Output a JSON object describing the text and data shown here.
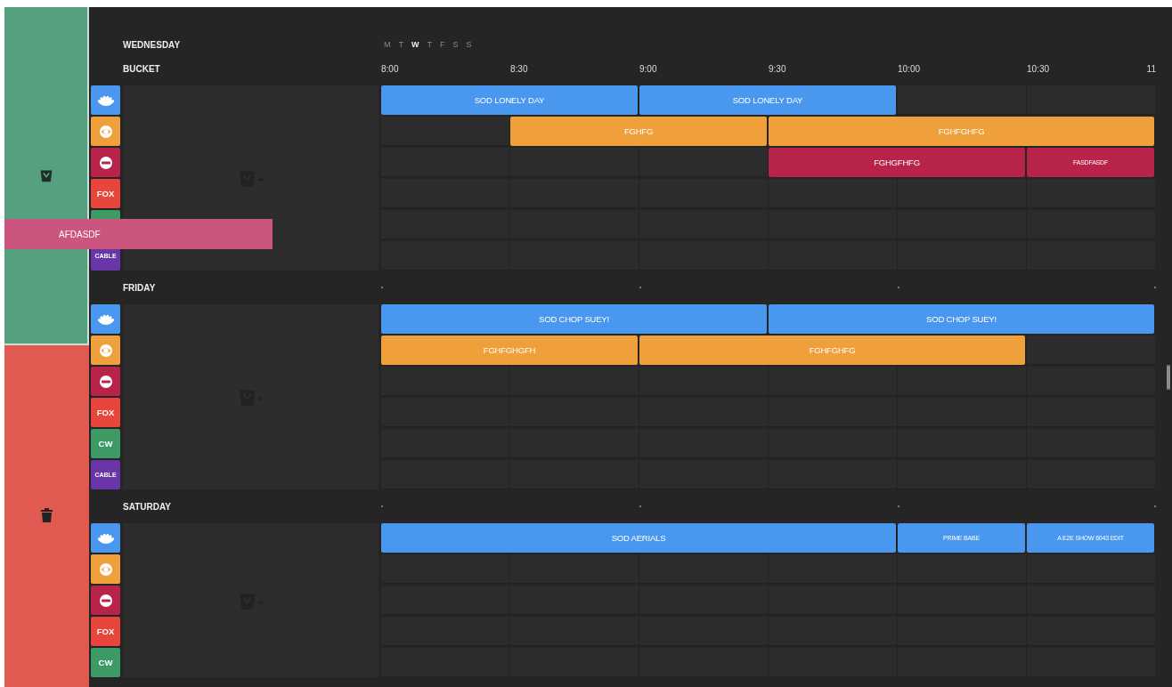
{
  "top_bar": {
    "day": "WEDNESDAY",
    "weekdays": [
      {
        "label": "M",
        "selected": false
      },
      {
        "label": "T",
        "selected": false
      },
      {
        "label": "W",
        "selected": true
      },
      {
        "label": "T",
        "selected": false
      },
      {
        "label": "F",
        "selected": false
      },
      {
        "label": "S",
        "selected": false
      },
      {
        "label": "S",
        "selected": false
      }
    ]
  },
  "header": {
    "bucket_label": "BUCKET",
    "times": [
      "8:00",
      "8:30",
      "9:00",
      "9:30",
      "10:00",
      "10:30",
      "11"
    ]
  },
  "dragged_program": {
    "title": "AFDASDF"
  },
  "days": [
    {
      "rows": [
        {
          "channel": {
            "kind": "nbc",
            "color": "#4a97f0"
          },
          "slots": [
            {
              "kind": "program",
              "title": "SOD LONELY DAY"
            },
            {
              "kind": "continued"
            },
            {
              "kind": "program",
              "title": "SOD LONELY DAY"
            },
            {
              "kind": "continued"
            },
            {
              "kind": "empty"
            },
            {
              "kind": "empty"
            }
          ]
        },
        {
          "channel": {
            "kind": "cbs",
            "color": "#f0a03a"
          },
          "slots": [
            {
              "kind": "empty"
            },
            {
              "kind": "program",
              "title": "FGHFG"
            },
            {
              "kind": "continued"
            },
            {
              "kind": "program",
              "title": "FGHFGHFG"
            },
            {
              "kind": "continued"
            },
            {
              "kind": "continued"
            }
          ]
        },
        {
          "channel": {
            "kind": "abc",
            "color": "#b8234a"
          },
          "slots": [
            {
              "kind": "empty"
            },
            {
              "kind": "empty"
            },
            {
              "kind": "empty"
            },
            {
              "kind": "program",
              "title": "FGHGFHFG"
            },
            {
              "kind": "continued"
            },
            {
              "kind": "program",
              "title": "FASDFASDF"
            }
          ]
        },
        {
          "channel": {
            "kind": "text",
            "label": "FOX",
            "color": "#e8453c"
          },
          "slots": [
            {
              "kind": "empty"
            },
            {
              "kind": "empty"
            },
            {
              "kind": "empty"
            },
            {
              "kind": "empty"
            },
            {
              "kind": "empty"
            },
            {
              "kind": "empty"
            }
          ]
        },
        {
          "channel": {
            "kind": "text",
            "color": "#3e9a64"
          },
          "slots": [
            {
              "kind": "empty"
            },
            {
              "kind": "empty"
            },
            {
              "kind": "empty"
            },
            {
              "kind": "empty"
            },
            {
              "kind": "empty"
            },
            {
              "kind": "empty"
            }
          ]
        },
        {
          "channel": {
            "kind": "text",
            "label": "CABLE",
            "color": "#6a35a8"
          },
          "slots": [
            {
              "kind": "empty"
            },
            {
              "kind": "empty"
            },
            {
              "kind": "empty"
            },
            {
              "kind": "empty"
            },
            {
              "kind": "empty"
            },
            {
              "kind": "empty"
            }
          ]
        }
      ]
    },
    {
      "name": "FRIDAY",
      "rows": [
        {
          "channel": {
            "kind": "nbc",
            "color": "#4a97f0"
          },
          "slots": [
            {
              "kind": "program",
              "title": "SOD CHOP SUEY!"
            },
            {
              "kind": "continued"
            },
            {
              "kind": "continued"
            },
            {
              "kind": "program",
              "title": "SOD CHOP SUEY!"
            },
            {
              "kind": "continued"
            },
            {
              "kind": "continued"
            }
          ]
        },
        {
          "channel": {
            "kind": "cbs",
            "color": "#f0a03a"
          },
          "slots": [
            {
              "kind": "program",
              "title": "FGHFGHGFH"
            },
            {
              "kind": "continued"
            },
            {
              "kind": "program",
              "title": "FGHFGHFG"
            },
            {
              "kind": "continued"
            },
            {
              "kind": "continued"
            },
            {
              "kind": "empty"
            }
          ]
        },
        {
          "channel": {
            "kind": "abc",
            "color": "#b8234a"
          },
          "slots": [
            {
              "kind": "empty"
            },
            {
              "kind": "empty"
            },
            {
              "kind": "empty"
            },
            {
              "kind": "empty"
            },
            {
              "kind": "empty"
            },
            {
              "kind": "empty"
            }
          ]
        },
        {
          "channel": {
            "kind": "text",
            "label": "FOX",
            "color": "#e8453c"
          },
          "slots": [
            {
              "kind": "empty"
            },
            {
              "kind": "empty"
            },
            {
              "kind": "empty"
            },
            {
              "kind": "empty"
            },
            {
              "kind": "empty"
            },
            {
              "kind": "empty"
            }
          ]
        },
        {
          "channel": {
            "kind": "text",
            "label": "CW",
            "color": "#3e9a64"
          },
          "slots": [
            {
              "kind": "empty"
            },
            {
              "kind": "empty"
            },
            {
              "kind": "empty"
            },
            {
              "kind": "empty"
            },
            {
              "kind": "empty"
            },
            {
              "kind": "empty"
            }
          ]
        },
        {
          "channel": {
            "kind": "text",
            "label": "CABLE",
            "color": "#6a35a8"
          },
          "slots": [
            {
              "kind": "empty"
            },
            {
              "kind": "empty"
            },
            {
              "kind": "empty"
            },
            {
              "kind": "empty"
            },
            {
              "kind": "empty"
            },
            {
              "kind": "empty"
            }
          ]
        }
      ]
    },
    {
      "name": "SATURDAY",
      "rows": [
        {
          "channel": {
            "kind": "nbc",
            "color": "#4a97f0"
          },
          "slots": [
            {
              "kind": "program",
              "title": "SOD AERIALS"
            },
            {
              "kind": "continued"
            },
            {
              "kind": "continued"
            },
            {
              "kind": "continued"
            },
            {
              "kind": "program",
              "title": "PRIME BABE"
            },
            {
              "kind": "program",
              "title": "A E2E SHOW 6043 EDIT"
            }
          ]
        },
        {
          "channel": {
            "kind": "cbs",
            "color": "#f0a03a"
          },
          "slots": [
            {
              "kind": "empty"
            },
            {
              "kind": "empty"
            },
            {
              "kind": "empty"
            },
            {
              "kind": "empty"
            },
            {
              "kind": "empty"
            },
            {
              "kind": "empty"
            }
          ]
        },
        {
          "channel": {
            "kind": "abc",
            "color": "#b8234a"
          },
          "slots": [
            {
              "kind": "empty"
            },
            {
              "kind": "empty"
            },
            {
              "kind": "empty"
            },
            {
              "kind": "empty"
            },
            {
              "kind": "empty"
            },
            {
              "kind": "empty"
            }
          ]
        },
        {
          "channel": {
            "kind": "text",
            "label": "FOX",
            "color": "#e8453c"
          },
          "slots": [
            {
              "kind": "empty"
            },
            {
              "kind": "empty"
            },
            {
              "kind": "empty"
            },
            {
              "kind": "empty"
            },
            {
              "kind": "empty"
            },
            {
              "kind": "empty"
            }
          ]
        },
        {
          "channel": {
            "kind": "text",
            "label": "CW",
            "color": "#3e9a64"
          },
          "slots": [
            {
              "kind": "empty"
            },
            {
              "kind": "empty"
            },
            {
              "kind": "empty"
            },
            {
              "kind": "empty"
            },
            {
              "kind": "empty"
            },
            {
              "kind": "empty"
            }
          ]
        }
      ]
    }
  ]
}
